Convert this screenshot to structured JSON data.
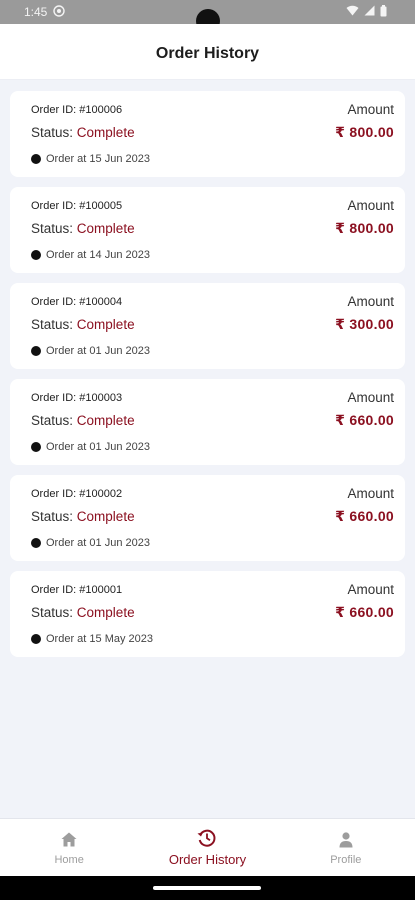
{
  "status_bar": {
    "time": "1:45"
  },
  "app_bar": {
    "title": "Order History"
  },
  "colors": {
    "accent": "#8b1020",
    "background": "#f1f3f9"
  },
  "labels": {
    "amount": "Amount",
    "status_prefix": "Status:"
  },
  "orders": [
    {
      "order_id": "Order ID: #100006",
      "status": "Complete",
      "date": "Order at 15 Jun 2023",
      "amount": "₹ 800.00"
    },
    {
      "order_id": "Order ID: #100005",
      "status": "Complete",
      "date": "Order at 14 Jun 2023",
      "amount": "₹ 800.00"
    },
    {
      "order_id": "Order ID: #100004",
      "status": "Complete",
      "date": "Order at 01 Jun 2023",
      "amount": "₹ 300.00"
    },
    {
      "order_id": "Order ID: #100003",
      "status": "Complete",
      "date": "Order at 01 Jun 2023",
      "amount": "₹ 660.00"
    },
    {
      "order_id": "Order ID: #100002",
      "status": "Complete",
      "date": "Order at 01 Jun 2023",
      "amount": "₹ 660.00"
    },
    {
      "order_id": "Order ID: #100001",
      "status": "Complete",
      "date": "Order at 15 May 2023",
      "amount": "₹ 660.00"
    }
  ],
  "bottom_nav": [
    {
      "label": "Home",
      "icon": "home-icon",
      "active": false
    },
    {
      "label": "Order History",
      "icon": "history-icon",
      "active": true
    },
    {
      "label": "Profile",
      "icon": "person-icon",
      "active": false
    }
  ]
}
